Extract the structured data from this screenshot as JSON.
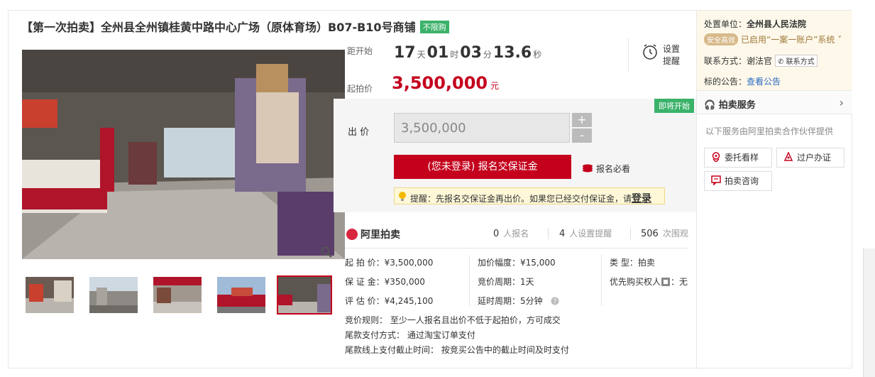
{
  "title": {
    "text": "【第一次拍卖】全州县全州镇桂黄中路中心广场（原体育场）B07-B10号商铺",
    "tag": "不限购"
  },
  "countdown": {
    "label": "距开始",
    "days": "17",
    "days_unit": "天",
    "hours": "01",
    "hours_unit": "时",
    "minutes": "03",
    "minutes_unit": "分",
    "seconds": "13.6",
    "seconds_unit": "秒"
  },
  "reminder": {
    "label": "设置提醒"
  },
  "start_price": {
    "label": "起拍价",
    "value": "3,500,000",
    "unit": "元"
  },
  "bid": {
    "badge": "即将开始",
    "label": "出  价",
    "value": "3,500,000",
    "plus": "+",
    "minus": "-",
    "button": "(您未登录) 报名交保证金",
    "must_read": "报名必看",
    "tip_text": "提醒：先报名交保证金再出价。如果您已经交付保证金，请",
    "tip_link": "登录"
  },
  "platform": {
    "name": "阿里拍卖"
  },
  "stats": [
    {
      "num": "0",
      "label": "人报名"
    },
    {
      "num": "4",
      "label": "人设置提醒"
    },
    {
      "num": "506",
      "label": "次围观"
    }
  ],
  "details": {
    "start": "起 拍 价：¥3,500,000",
    "deposit": "保 证 金：¥350,000",
    "estimate": "评 估 价：¥4,245,100",
    "increment": "加价幅度：¥15,000",
    "period": "竞价周期：1天",
    "delay": "延时周期：5分钟",
    "type_label": "类      型：",
    "type_value": "拍卖",
    "priority_label": "优先购买权人",
    "priority_value": "：无"
  },
  "rules": {
    "rule": "竞价规则：  至少一人报名且出价不低于起拍价，方可成交",
    "payment": "尾款支付方式：  通过淘宝订单支付",
    "deadline": "尾款线上支付截止时间：  按竞买公告中的截止时间及时支付"
  },
  "side": {
    "unit_label": "处置单位：",
    "unit_value": "全州县人民法院",
    "safe_badge": "安全高效",
    "system_text": "已启用“一案一账户”系统",
    "contact_label": "联系方式：",
    "contact_value": "谢法官",
    "contact_btn": "联系方式",
    "notice_label": "标的公告：",
    "notice_link": "查看公告",
    "service_title": "拍卖服务",
    "service_desc": "以下服务由阿里拍卖合作伙伴提供",
    "btn_view": "委托看样",
    "btn_transfer": "过户办证",
    "btn_consult": "拍卖咨询"
  },
  "colors": {
    "accent": "#c4001d",
    "green": "#3bb26a",
    "link": "#2d6bc4"
  }
}
